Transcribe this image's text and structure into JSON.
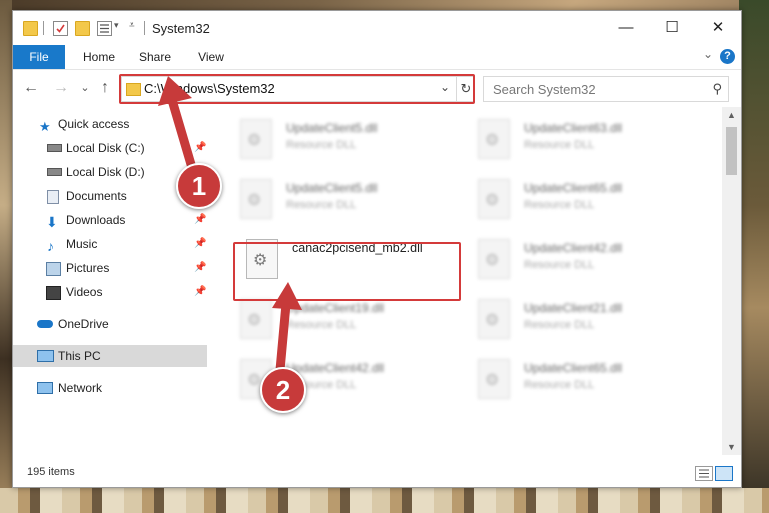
{
  "window": {
    "title": "System32"
  },
  "titlebar": {
    "minimize": "—",
    "maximize": "☐",
    "close": "✕"
  },
  "ribbon": {
    "tabs": [
      "File",
      "Home",
      "Share",
      "View"
    ],
    "help": "?",
    "collapse": "⌄"
  },
  "nav": {
    "back": "←",
    "forward": "→",
    "recent": "⌄",
    "up": "↑",
    "address": "C:\\Windows\\System32",
    "search_placeholder": "Search System32"
  },
  "sidebar": {
    "items": [
      {
        "label": "Quick access",
        "icon": "star-icon",
        "pinned": false
      },
      {
        "label": "Local Disk (C:)",
        "icon": "drive-icon",
        "pinned": true
      },
      {
        "label": "Local Disk (D:)",
        "icon": "drive-icon",
        "pinned": false
      },
      {
        "label": "Documents",
        "icon": "documents-icon",
        "pinned": false
      },
      {
        "label": "Downloads",
        "icon": "download-icon",
        "pinned": true
      },
      {
        "label": "Music",
        "icon": "music-icon",
        "pinned": true
      },
      {
        "label": "Pictures",
        "icon": "pictures-icon",
        "pinned": true
      },
      {
        "label": "Videos",
        "icon": "videos-icon",
        "pinned": true
      },
      {
        "label": "OneDrive",
        "icon": "cloud-icon",
        "pinned": false
      },
      {
        "label": "This PC",
        "icon": "computer-icon",
        "pinned": false,
        "selected": true
      },
      {
        "label": "Network",
        "icon": "network-icon",
        "pinned": false
      }
    ]
  },
  "files": [
    {
      "name": "UpdateClient5.dll",
      "type": "Resource DLL"
    },
    {
      "name": "UpdateClient63.dll",
      "type": "Resource DLL"
    },
    {
      "name": "UpdateClient5.dll",
      "type": "Resource DLL"
    },
    {
      "name": "UpdateClient65.dll",
      "type": "Resource DLL"
    },
    {
      "name": "canac2pcisend_mb2.dll",
      "type": ""
    },
    {
      "name": "UpdateClient42.dll",
      "type": "Resource DLL"
    },
    {
      "name": "UpdateClient19.dll",
      "type": "Resource DLL"
    },
    {
      "name": "UpdateClient21.dll",
      "type": "Resource DLL"
    },
    {
      "name": "UpdateClient42.dll",
      "type": "Resource DLL"
    },
    {
      "name": "UpdateClient65.dll",
      "type": "Resource DLL"
    }
  ],
  "status": {
    "item_count": "195 items"
  },
  "callouts": {
    "one": "1",
    "two": "2"
  },
  "colors": {
    "accent": "#1979ca",
    "highlight": "#d43a3a",
    "badge": "#c73a3a"
  }
}
